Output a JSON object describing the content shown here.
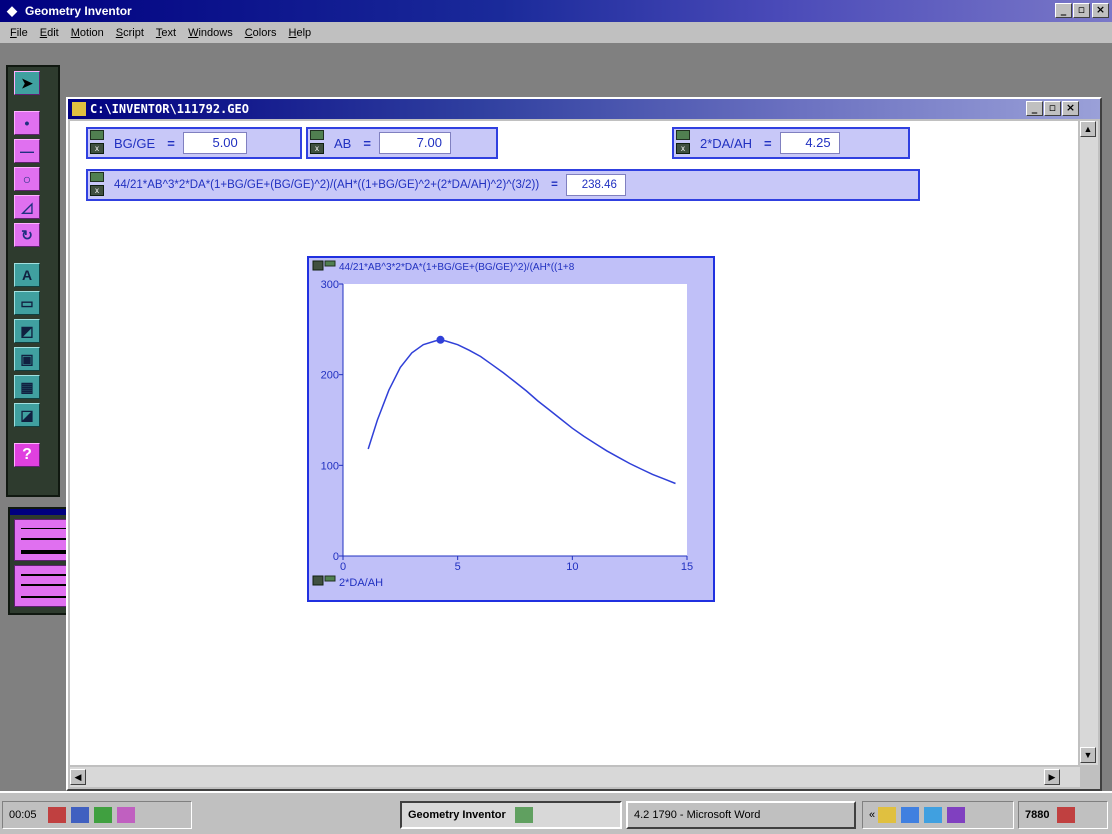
{
  "app": {
    "title": "Geometry Inventor",
    "controls": {
      "minimize": "_",
      "maximize": "▫",
      "close": "×"
    }
  },
  "menu": [
    "File",
    "Edit",
    "Motion",
    "Script",
    "Text",
    "Windows",
    "Colors",
    "Help"
  ],
  "document": {
    "title": "C:\\INVENTOR\\111792.GEO"
  },
  "expressions": {
    "bg_ge": {
      "label": "BG/GE",
      "equals": "=",
      "value": "5.00"
    },
    "ab": {
      "label": "AB",
      "equals": "=",
      "value": "7.00"
    },
    "da_ah": {
      "label": "2*DA/AH",
      "equals": "=",
      "value": "4.25"
    },
    "formula": {
      "label": "44/21*AB^3*2*DA*(1+BG/GE+(BG/GE)^2)/(AH*((1+BG/GE)^2+(2*DA/AH)^2)^(3/2))",
      "equals": "=",
      "value": "238.46"
    }
  },
  "chart_data": {
    "type": "line",
    "title": "44/21*AB^3*2*DA*(1+BG/GE+(BG/GE)^2)/(AH*((1+8",
    "xlabel": "2*DA/AH",
    "xlim": [
      0,
      15
    ],
    "ylim": [
      0,
      300
    ],
    "xticks": [
      "0",
      "5",
      "10",
      "15"
    ],
    "yticks": [
      "0",
      "100",
      "200",
      "300"
    ],
    "x": [
      1.1,
      1.5,
      2.0,
      2.5,
      3.0,
      3.5,
      4.0,
      4.25,
      4.5,
      5.0,
      5.5,
      6.0,
      6.5,
      7.0,
      7.5,
      8.0,
      8.5,
      9.0,
      9.5,
      10.0,
      10.5,
      11.0,
      11.5,
      12.0,
      12.5,
      13.0,
      13.5,
      14.0,
      14.5
    ],
    "y": [
      118,
      150,
      183,
      208,
      224,
      233,
      237,
      238.5,
      237,
      233,
      227,
      220,
      211,
      202,
      192,
      182,
      171,
      161,
      151,
      141,
      132,
      124,
      116,
      109,
      102,
      96,
      90,
      85,
      80
    ],
    "marker": {
      "x": 4.25,
      "y": 238.46
    },
    "color": "#3040d8"
  },
  "tools": {
    "arrow": "arrow-icon",
    "point": "point-icon",
    "segment": "segment-icon",
    "circle": "circle-icon",
    "triangle": "triangle-icon",
    "arc": "arc-icon",
    "text": "A",
    "measure": "ruler-icon",
    "transform": "transform-icon",
    "calc": "calc-icon",
    "table": "table-icon",
    "graph": "graph-icon",
    "help": "?"
  },
  "taskbar": {
    "clock": "00:05",
    "task_geometry": "Geometry Inventor",
    "task_word": "4.2 1790 - Microsoft Word",
    "tray_value": "7880"
  }
}
